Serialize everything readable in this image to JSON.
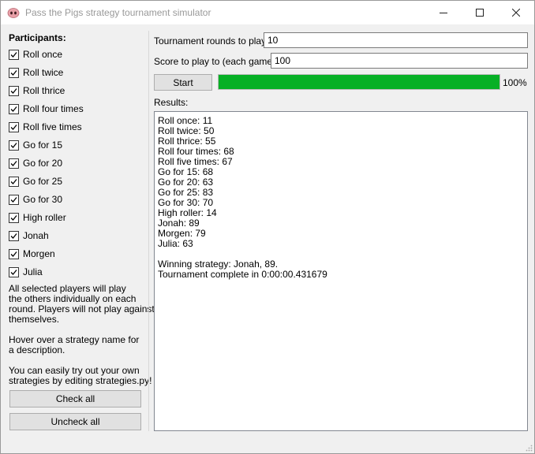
{
  "window": {
    "title": "Pass the Pigs strategy tournament simulator"
  },
  "participants": {
    "title": "Participants:",
    "items": [
      {
        "label": "Roll once",
        "checked": true
      },
      {
        "label": "Roll twice",
        "checked": true
      },
      {
        "label": "Roll thrice",
        "checked": true
      },
      {
        "label": "Roll four times",
        "checked": true
      },
      {
        "label": "Roll five times",
        "checked": true
      },
      {
        "label": "Go for 15",
        "checked": true
      },
      {
        "label": "Go for 20",
        "checked": true
      },
      {
        "label": "Go for 25",
        "checked": true
      },
      {
        "label": "Go for 30",
        "checked": true
      },
      {
        "label": "High roller",
        "checked": true
      },
      {
        "label": "Jonah",
        "checked": true
      },
      {
        "label": "Morgen",
        "checked": true
      },
      {
        "label": "Julia",
        "checked": true
      }
    ],
    "info": [
      "All selected players will play",
      "the others individually on each",
      "round. Players will not play against",
      "themselves.",
      "",
      "Hover over a strategy name for",
      "a description.",
      "",
      "You can easily try out your own",
      "strategies by editing strategies.py!"
    ],
    "check_all_label": "Check all",
    "uncheck_all_label": "Uncheck all"
  },
  "settings": {
    "rounds_label": "Tournament rounds to play:",
    "rounds_value": "10",
    "score_label": "Score to play to (each game):",
    "score_value": "100",
    "start_label": "Start",
    "progress_percent": 100,
    "progress_text": "100%"
  },
  "results": {
    "label": "Results:",
    "lines": [
      "Roll once: 11",
      "Roll twice: 50",
      "Roll thrice: 55",
      "Roll four times: 68",
      "Roll five times: 67",
      "Go for 15: 68",
      "Go for 20: 63",
      "Go for 25: 83",
      "Go for 30: 70",
      "High roller: 14",
      "Jonah: 89",
      "Morgen: 79",
      "Julia: 63",
      "",
      "Winning strategy: Jonah, 89.",
      "Tournament complete in 0:00:00.431679"
    ]
  },
  "colors": {
    "progress_fill": "#06b025",
    "app_icon": "#e8a0a8"
  }
}
